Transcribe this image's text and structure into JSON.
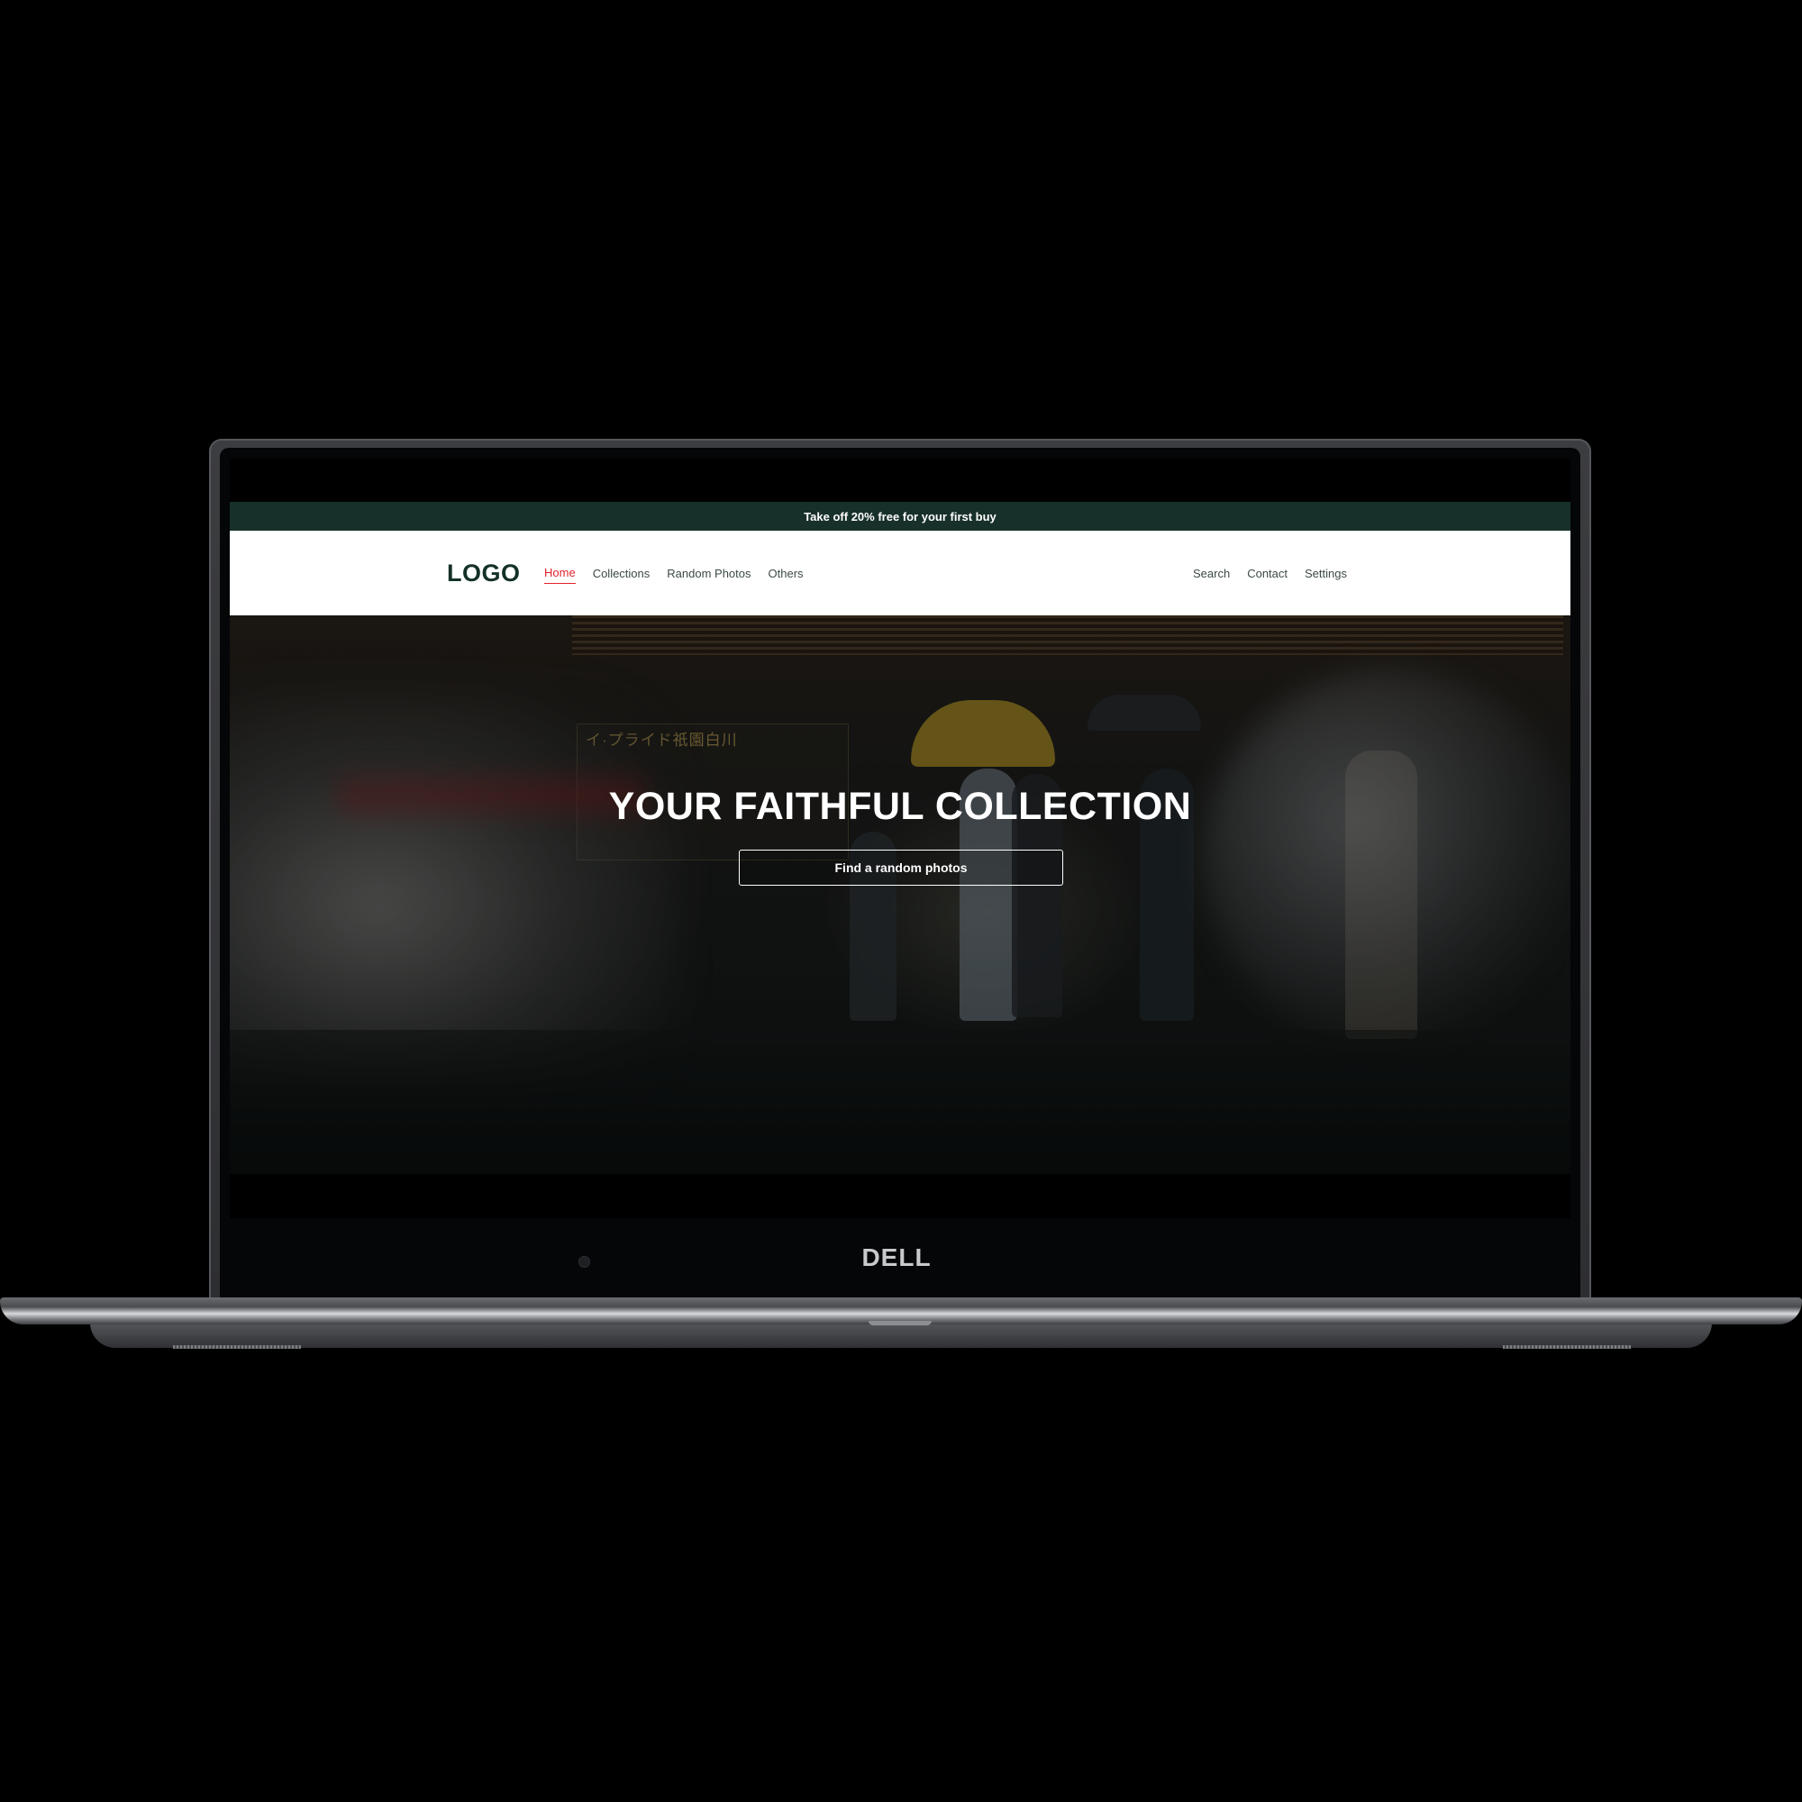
{
  "promo": {
    "text": "Take off 20% free for your first buy"
  },
  "navbar": {
    "logo": "LOGO",
    "left_links": [
      {
        "label": "Home",
        "active": true
      },
      {
        "label": "Collections",
        "active": false
      },
      {
        "label": "Random Photos",
        "active": false
      },
      {
        "label": "Others",
        "active": false
      }
    ],
    "right_links": [
      {
        "label": "Search"
      },
      {
        "label": "Contact"
      },
      {
        "label": "Settings"
      }
    ]
  },
  "hero": {
    "title": "YOUR FAITHFUL COLLECTION",
    "button_label": "Find a random photos",
    "sign_text": "イ·プライド祇園白川"
  },
  "device": {
    "brand": "DELL"
  },
  "colors": {
    "promo_bg": "#18302a",
    "logo": "#143127",
    "active_link": "#e0232e",
    "nav_text": "#3c4a45"
  }
}
